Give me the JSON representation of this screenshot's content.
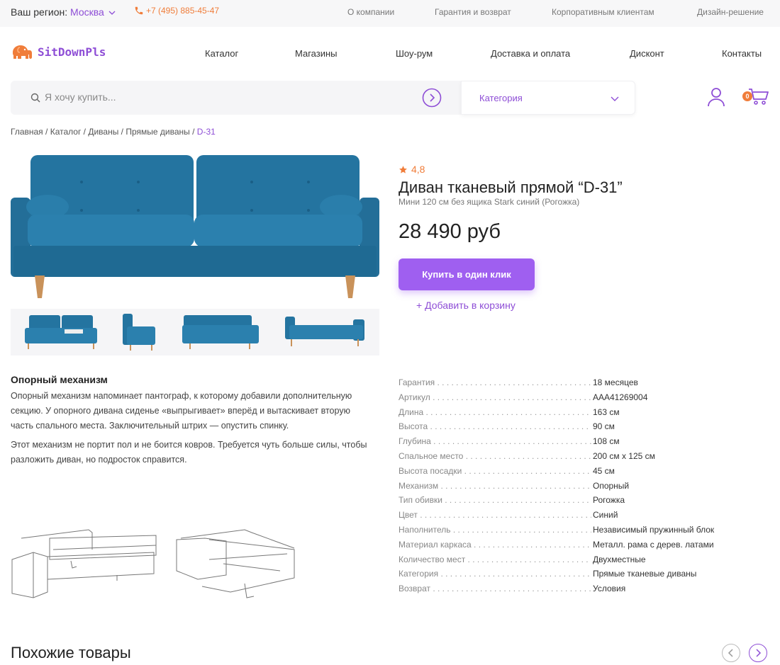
{
  "topbar": {
    "region_label": "Ваш регион:",
    "region_city": "Москва",
    "phone": "+7 (495) 885-45-47",
    "links": [
      "О компании",
      "Гарантия и возврат",
      "Корпоративным клиентам",
      "Дизайн-решение"
    ]
  },
  "brand": {
    "name": "SitDownPls",
    "accent": "#8e4ed6",
    "orange": "#f07d3a"
  },
  "nav": [
    "Каталог",
    "Магазины",
    "Шоу-рум",
    "Доставка и оплата",
    "Дисконт",
    "Контакты"
  ],
  "search": {
    "placeholder": "Я хочу купить...",
    "category": "Категория"
  },
  "cart": {
    "count": "0"
  },
  "breadcrumbs": [
    "Главная",
    "Каталог",
    "Диваны",
    "Прямые диваны",
    "D-31"
  ],
  "product": {
    "rating": "4,8",
    "title": "Диван тканевый прямой “D-31”",
    "subtitle": "Мини 120 см без ящика Stark синий (Рогожка)",
    "price": "28 490 руб",
    "buy_label": "Купить в один клик",
    "add_label": "+ Добавить в корзину"
  },
  "mechanism": {
    "title": "Опорный механизм",
    "p1": "Опорный механизм напоминает пантограф, к которому добавили дополнительную секцию. У опорного дивана сиденье «выпрыгивает» вперёд и вытаскивает вторую часть спального места. Заключительный штрих — опустить спинку.",
    "p2": "Этот механизм не портит пол и не боится ковров. Требуется чуть больше силы, чтобы разложить диван, но подросток справится."
  },
  "specs": [
    {
      "k": "Гарантия",
      "v": "18 месяцев"
    },
    {
      "k": "Артикул",
      "v": "AAA41269004"
    },
    {
      "k": "Длина",
      "v": "163 см"
    },
    {
      "k": "Высота",
      "v": "90 см"
    },
    {
      "k": "Глубина",
      "v": "108 см"
    },
    {
      "k": "Спальное место",
      "v": "200 см х 125 см"
    },
    {
      "k": "Высота посадки",
      "v": "45 см"
    },
    {
      "k": "Механизм",
      "v": "Опорный"
    },
    {
      "k": "Тип обивки",
      "v": "Рогожка"
    },
    {
      "k": "Цвет",
      "v": "Синий"
    },
    {
      "k": "Наполнитель",
      "v": "Независимый пружинный блок"
    },
    {
      "k": "Материал каркаса",
      "v": "Металл. рама с дерев. латами"
    },
    {
      "k": "Количество мест",
      "v": "Двухместные"
    },
    {
      "k": "Категория",
      "v": "Прямые тканевые диваны"
    },
    {
      "k": "Возврат",
      "v": "Условия"
    }
  ],
  "similar": {
    "title": "Похожие товары"
  }
}
